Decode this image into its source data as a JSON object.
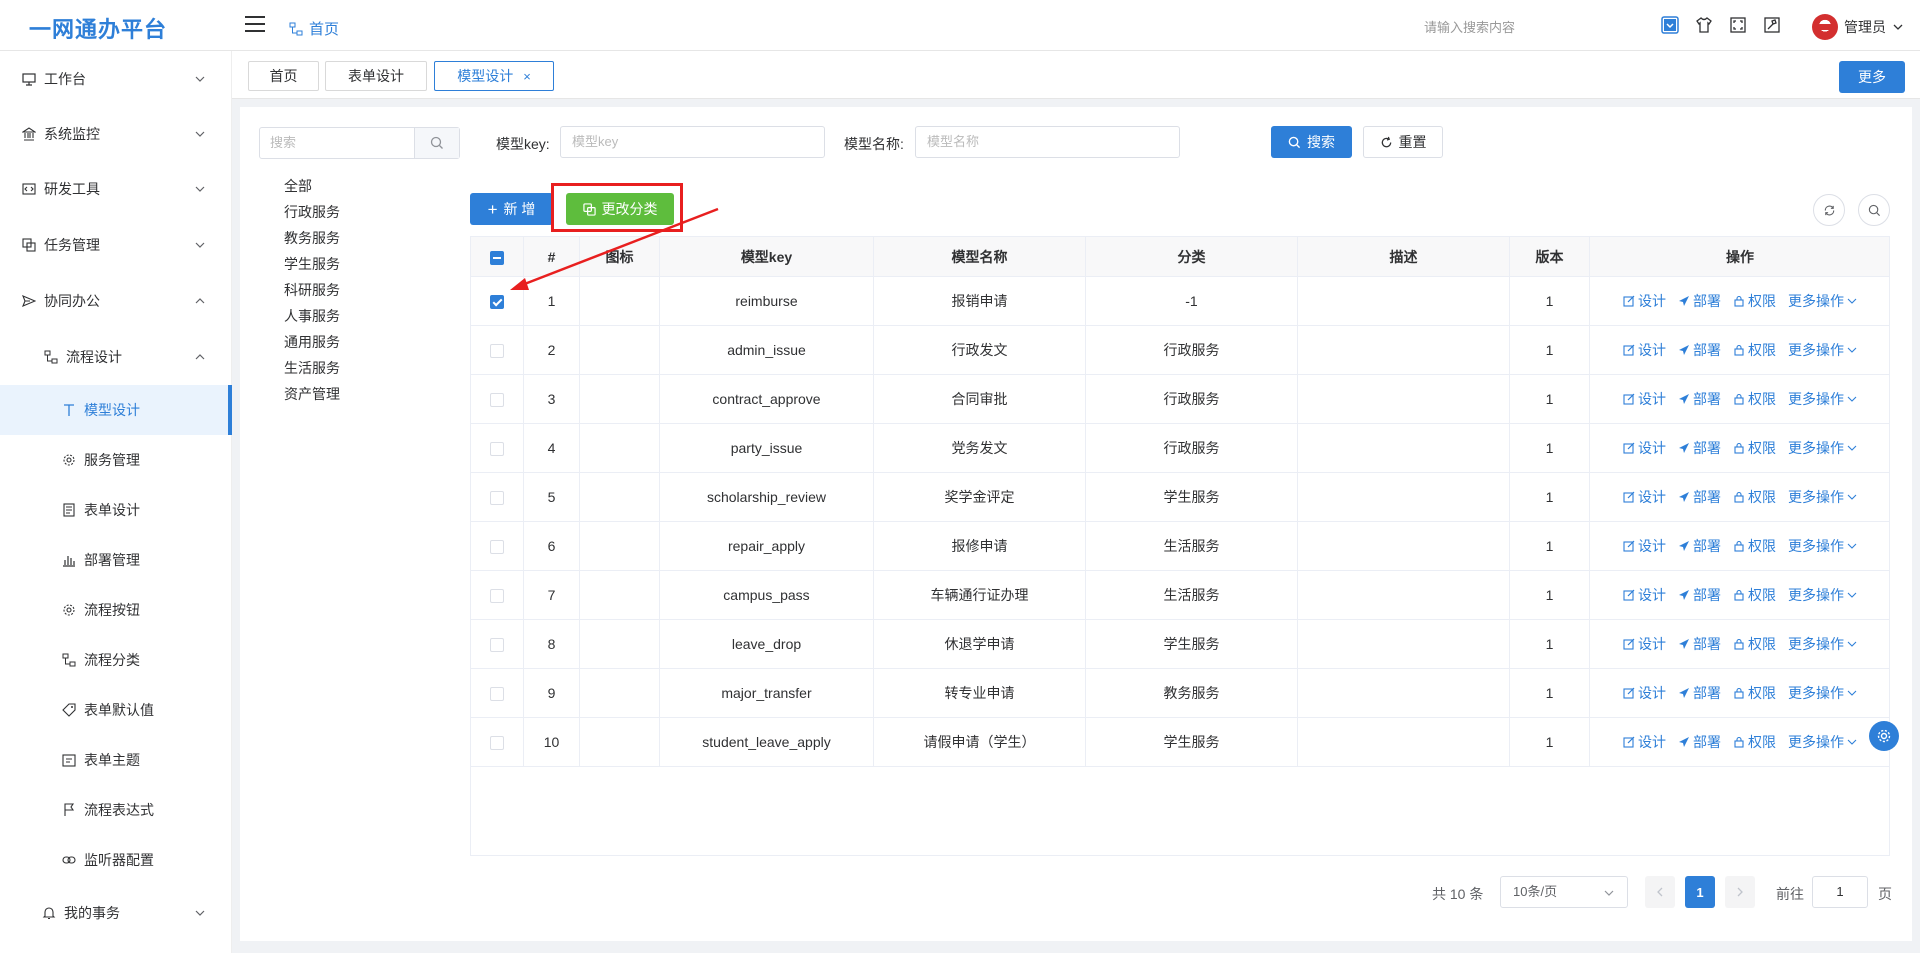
{
  "app": {
    "title": "一网通办平台",
    "home_link": "首页",
    "search_hint": "请输入搜索内容",
    "user": "管理员"
  },
  "sidebar": {
    "items": [
      {
        "label": "工作台",
        "icon": "monitor-icon",
        "expanded": false
      },
      {
        "label": "系统监控",
        "icon": "bank-icon",
        "expanded": false
      },
      {
        "label": "研发工具",
        "icon": "code-icon",
        "expanded": false
      },
      {
        "label": "任务管理",
        "icon": "copy-icon",
        "expanded": false
      },
      {
        "label": "协同办公",
        "icon": "send-icon",
        "expanded": true
      },
      {
        "label": "流程设计",
        "icon": "flow-icon",
        "expanded": true
      },
      {
        "label": "模型设计",
        "icon": "text-icon",
        "active": true
      },
      {
        "label": "服务管理",
        "icon": "gear-icon"
      },
      {
        "label": "表单设计",
        "icon": "form-icon"
      },
      {
        "label": "部署管理",
        "icon": "bar-chart-icon"
      },
      {
        "label": "流程按钮",
        "icon": "gear-icon"
      },
      {
        "label": "流程分类",
        "icon": "flow-icon"
      },
      {
        "label": "表单默认值",
        "icon": "tag-icon"
      },
      {
        "label": "表单主题",
        "icon": "calendar-icon"
      },
      {
        "label": "流程表达式",
        "icon": "flag-icon"
      },
      {
        "label": "监听器配置",
        "icon": "link-icon"
      },
      {
        "label": "我的事务",
        "icon": "bell-icon",
        "expanded": false
      }
    ]
  },
  "tabs": [
    {
      "label": "首页"
    },
    {
      "label": "表单设计"
    },
    {
      "label": "模型设计",
      "active": true
    }
  ],
  "more_label": "更多",
  "category": {
    "search_placeholder": "搜索",
    "items": [
      "全部",
      "行政服务",
      "教务服务",
      "学生服务",
      "科研服务",
      "人事服务",
      "通用服务",
      "生活服务",
      "资产管理"
    ]
  },
  "filters": {
    "key_label": "模型key:",
    "key_placeholder": "模型key",
    "name_label": "模型名称:",
    "name_placeholder": "模型名称",
    "search_label": "搜索",
    "reset_label": "重置"
  },
  "toolbar": {
    "add_label": "新 增",
    "change_category_label": "更改分类"
  },
  "table": {
    "headers": [
      "#",
      "图标",
      "模型key",
      "模型名称",
      "分类",
      "描述",
      "版本",
      "操作"
    ],
    "ops": {
      "design": "设计",
      "deploy": "部署",
      "perm": "权限",
      "more": "更多操作"
    },
    "rows": [
      {
        "no": "1",
        "key": "reimburse",
        "name": "报销申请",
        "category": "-1",
        "version": "1",
        "checked": true
      },
      {
        "no": "2",
        "key": "admin_issue",
        "name": "行政发文",
        "category": "行政服务",
        "version": "1",
        "checked": false
      },
      {
        "no": "3",
        "key": "contract_approve",
        "name": "合同审批",
        "category": "行政服务",
        "version": "1",
        "checked": false
      },
      {
        "no": "4",
        "key": "party_issue",
        "name": "党务发文",
        "category": "行政服务",
        "version": "1",
        "checked": false
      },
      {
        "no": "5",
        "key": "scholarship_review",
        "name": "奖学金评定",
        "category": "学生服务",
        "version": "1",
        "checked": false
      },
      {
        "no": "6",
        "key": "repair_apply",
        "name": "报修申请",
        "category": "生活服务",
        "version": "1",
        "checked": false
      },
      {
        "no": "7",
        "key": "campus_pass",
        "name": "车辆通行证办理",
        "category": "生活服务",
        "version": "1",
        "checked": false
      },
      {
        "no": "8",
        "key": "leave_drop",
        "name": "休退学申请",
        "category": "学生服务",
        "version": "1",
        "checked": false
      },
      {
        "no": "9",
        "key": "major_transfer",
        "name": "转专业申请",
        "category": "教务服务",
        "version": "1",
        "checked": false
      },
      {
        "no": "10",
        "key": "student_leave_apply",
        "name": "请假申请（学生）",
        "category": "学生服务",
        "version": "1",
        "checked": false
      }
    ]
  },
  "pagination": {
    "total": "共 10 条",
    "page_size": "10条/页",
    "current": "1",
    "goto_prefix": "前往",
    "goto_value": "1",
    "goto_suffix": "页"
  },
  "colors": {
    "primary": "#2e7fd8",
    "success": "#5ebd3d",
    "highlight": "#e81f1f"
  }
}
